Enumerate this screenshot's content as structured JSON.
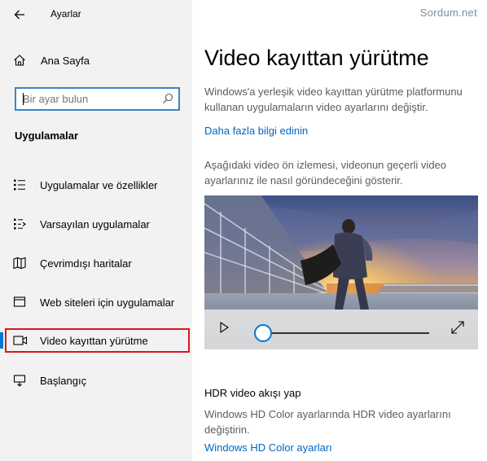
{
  "window": {
    "title": "Ayarlar",
    "watermark": "Sordum.net"
  },
  "sidebar": {
    "home_label": "Ana Sayfa",
    "search_placeholder": "Bir ayar bulun",
    "section_heading": "Uygulamalar",
    "items": [
      {
        "label": "Uygulamalar ve özellikler",
        "icon": "apps-features-icon"
      },
      {
        "label": "Varsayılan uygulamalar",
        "icon": "default-apps-icon"
      },
      {
        "label": "Çevrimdışı haritalar",
        "icon": "offline-maps-icon"
      },
      {
        "label": "Web siteleri için uygulamalar",
        "icon": "apps-for-websites-icon"
      },
      {
        "label": "Video kayıttan yürütme",
        "icon": "video-playback-icon",
        "selected": true
      },
      {
        "label": "Başlangıç",
        "icon": "startup-icon"
      }
    ]
  },
  "main": {
    "title": "Video kayıttan yürütme",
    "description": "Windows'a yerleşik video kayıttan yürütme platformunu kullanan uygulamaların video ayarlarını değiştir.",
    "learn_more_link": "Daha fazla bilgi edinin",
    "preview_description": "Aşağıdaki video ön izlemesi, videonun geçerli video ayarlarınız ile nasıl  göründeceğini gösterir.",
    "video": {
      "progress": 0.0
    },
    "hdr": {
      "title": "HDR video akışı yap",
      "description": "Windows HD Color ayarlarında HDR video ayarlarını değiştirin.",
      "link": "Windows HD Color ayarları"
    }
  },
  "colors": {
    "accent": "#0078d7",
    "link": "#0067c0",
    "highlight_frame": "#e0141e",
    "sidebar_bg": "#f2f2f2"
  }
}
